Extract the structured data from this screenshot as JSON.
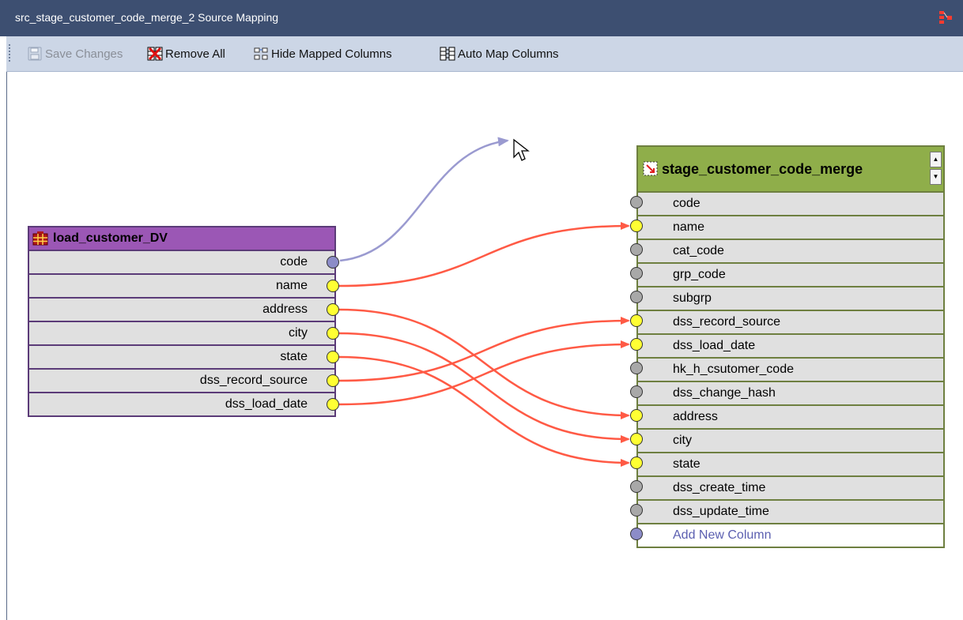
{
  "window": {
    "title": "src_stage_customer_code_merge_2 Source Mapping"
  },
  "toolbar": {
    "save_label": "Save Changes",
    "remove_all_label": "Remove All",
    "hide_mapped_label": "Hide Mapped Columns",
    "auto_map_label": "Auto Map Columns"
  },
  "source_table": {
    "name": "load_customer_DV",
    "columns": [
      "code",
      "name",
      "address",
      "city",
      "state",
      "dss_record_source",
      "dss_load_date"
    ],
    "dot_states": [
      "pending",
      "mapped",
      "mapped",
      "mapped",
      "mapped",
      "mapped",
      "mapped"
    ]
  },
  "target_table": {
    "name": "stage_customer_code_merge",
    "columns": [
      "code",
      "name",
      "cat_code",
      "grp_code",
      "subgrp",
      "dss_record_source",
      "dss_load_date",
      "hk_h_csutomer_code",
      "dss_change_hash",
      "address",
      "city",
      "state",
      "dss_create_time",
      "dss_update_time"
    ],
    "dot_states": [
      "unmapped",
      "mapped",
      "unmapped",
      "unmapped",
      "unmapped",
      "mapped",
      "mapped",
      "unmapped",
      "unmapped",
      "mapped",
      "mapped",
      "mapped",
      "unmapped",
      "unmapped"
    ],
    "add_new_label": "Add New Column"
  },
  "mappings": [
    {
      "from": "name",
      "to": "name"
    },
    {
      "from": "address",
      "to": "address"
    },
    {
      "from": "city",
      "to": "city"
    },
    {
      "from": "state",
      "to": "state"
    },
    {
      "from": "dss_record_source",
      "to": "dss_record_source"
    },
    {
      "from": "dss_load_date",
      "to": "dss_load_date"
    }
  ],
  "colors": {
    "titlebar": "#3d4f71",
    "toolbar": "#ccd6e6",
    "source_header": "#9b57b5",
    "target_header": "#8fae4a",
    "mapping_line": "#ff5a45",
    "drag_line": "#9a9ad0",
    "dot_mapped": "#ffff33",
    "dot_unmapped": "#a8a8a8",
    "dot_pending": "#8c8cc8"
  }
}
